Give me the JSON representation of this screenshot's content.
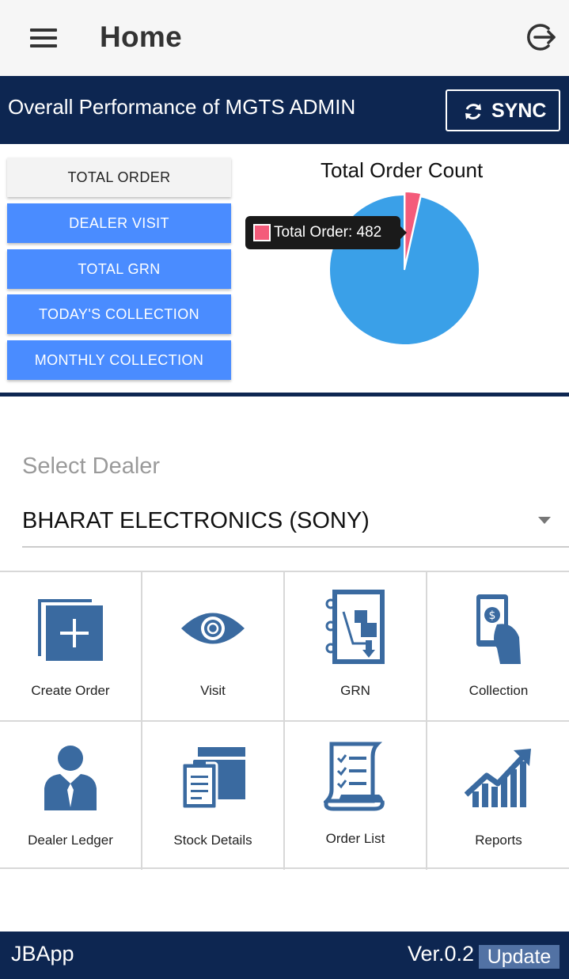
{
  "header": {
    "title": "Home",
    "menu_icon": "hamburger-menu-icon",
    "logout_icon": "logout-icon"
  },
  "performance": {
    "title": "Overall Performance of MGTS ADMIN",
    "sync_label": "SYNC",
    "buttons": [
      {
        "label": "TOTAL ORDER",
        "active": true
      },
      {
        "label": "DEALER VISIT",
        "active": false
      },
      {
        "label": "TOTAL GRN",
        "active": false
      },
      {
        "label": "TODAY'S COLLECTION",
        "active": false
      },
      {
        "label": "MONTHLY COLLECTION",
        "active": false
      }
    ]
  },
  "chart_data": {
    "type": "pie",
    "title": "Total Order Count",
    "tooltip": "Total Order: 482",
    "slices": [
      {
        "label": "Total Order",
        "value": 482,
        "fraction": 0.035,
        "color": "#f45b7a"
      },
      {
        "label": "",
        "fraction": 0.965,
        "color": "#3aa0e8"
      }
    ]
  },
  "dealer": {
    "label": "Select Dealer",
    "selected": "BHARAT ELECTRONICS (SONY)"
  },
  "tiles": [
    {
      "label": "Create Order",
      "icon": "create-order-icon"
    },
    {
      "label": "Visit",
      "icon": "eye-icon"
    },
    {
      "label": "GRN",
      "icon": "grn-icon"
    },
    {
      "label": "Collection",
      "icon": "collection-icon"
    },
    {
      "label": "Dealer Ledger",
      "icon": "dealer-ledger-icon"
    },
    {
      "label": "Stock Details",
      "icon": "stock-details-icon"
    },
    {
      "label": "Order List",
      "icon": "order-list-icon"
    },
    {
      "label": "Reports",
      "icon": "reports-icon"
    }
  ],
  "footer": {
    "app_name": "JBApp",
    "version": "Ver.0.2",
    "update_label": "Update"
  },
  "colors": {
    "navy": "#0d2651",
    "button_blue": "#4a8cff",
    "icon_blue": "#3a6aa0",
    "pie_blue": "#3aa0e8",
    "pie_pink": "#f45b7a"
  }
}
